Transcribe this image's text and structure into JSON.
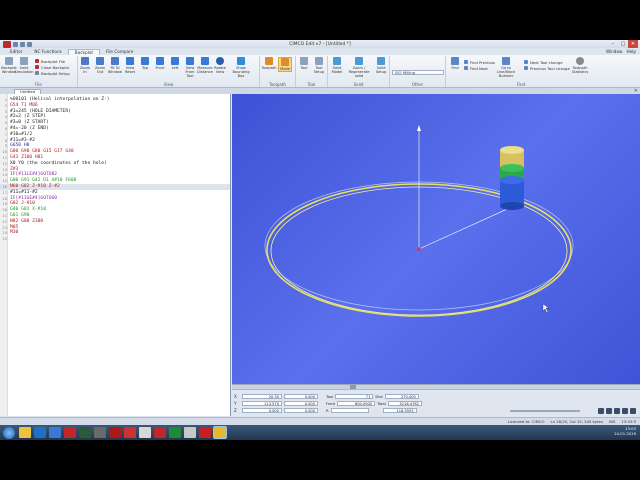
{
  "window": {
    "title": "CIMCO Edit v7 - [Untitled *]",
    "controls": [
      "–",
      "□",
      "✕"
    ]
  },
  "ribbon": {
    "tabs": [
      "Editor",
      "NC Functions",
      "Backplot",
      "File Compare"
    ],
    "active_tab": "Backplot",
    "right_items": [
      "Window",
      "Help"
    ],
    "groups": {
      "file": {
        "label": "File",
        "buttons": [
          "Backplot Window",
          "Solid Simulation"
        ],
        "small": [
          "Backplot File",
          "Close Backplot",
          "Backplot Setup"
        ]
      },
      "view": {
        "label": "View",
        "buttons": [
          "Zoom In",
          "Zoom Out",
          "Fit To Window",
          "View Reset",
          "Top",
          "Front",
          "Left",
          "View From Tool",
          "Measure Distance",
          "Rotate View",
          "Show Bounding Box"
        ]
      },
      "toolpath": {
        "label": "Toolpath",
        "buttons": [
          "Toolpath",
          "Mode"
        ]
      },
      "tool": {
        "label": "Tool",
        "buttons": [
          "Tool",
          "Tool Setup"
        ]
      },
      "solid": {
        "label": "Solid",
        "buttons": [
          "Solid Model",
          "Zoom / Regenerate solid",
          "Solid Setup"
        ]
      },
      "other": {
        "label": "Other",
        "combo_value": "ISO Milling"
      },
      "find": {
        "label": "Find",
        "buttons": [
          "Find"
        ],
        "small": [
          "Find Previous",
          "Find Next"
        ],
        "buttons2": [
          "Go to Line/Block Number"
        ],
        "small2": [
          "Next Tool change",
          "Previous Tool change"
        ],
        "buttons3": [
          "Toolpath Statistics"
        ]
      }
    }
  },
  "document": {
    "tab": "Untitled",
    "close_glyph": "✕"
  },
  "editor": {
    "lines": [
      {
        "n": "1",
        "parts": [
          {
            "t": "%O0101 (Helical interpolation on Z-)",
            "c": "black"
          }
        ]
      },
      {
        "n": "2",
        "parts": [
          {
            "t": "G54 T1 M06",
            "c": "red"
          }
        ]
      },
      {
        "n": "3",
        "parts": [
          {
            "t": "#1=245 (HOLE DIAMETER)",
            "c": "black"
          }
        ]
      },
      {
        "n": "4",
        "parts": [
          {
            "t": "#2=2 (Z STEP)",
            "c": "black"
          }
        ]
      },
      {
        "n": "5",
        "parts": [
          {
            "t": "#3=0 (Z START)",
            "c": "black"
          }
        ]
      },
      {
        "n": "6",
        "parts": [
          {
            "t": "#4=-20 (Z END)",
            "c": "black"
          }
        ]
      },
      {
        "n": "7",
        "parts": [
          {
            "t": "#10=#1/2",
            "c": "black"
          }
        ]
      },
      {
        "n": "8",
        "parts": [
          {
            "t": "#11=#3-#2",
            "c": "black"
          }
        ]
      },
      {
        "n": "9",
        "parts": [
          {
            "t": "G650 H0",
            "c": "blue"
          }
        ]
      },
      {
        "n": "10",
        "parts": [
          {
            "t": "G00 G90 G80 G15 G17 G40",
            "c": "red"
          }
        ]
      },
      {
        "n": "11",
        "parts": [
          {
            "t": "G43 Z100 H01",
            "c": "red"
          }
        ]
      },
      {
        "n": "12",
        "parts": [
          {
            "t": "X0 Y0 (the coordinates of the hole)",
            "c": "black"
          }
        ]
      },
      {
        "n": "13",
        "parts": [
          {
            "t": "Z#3",
            "c": "red"
          }
        ]
      },
      {
        "n": "14",
        "parts": [
          {
            "t": "IF[#11LE#4]GOTO82",
            "c": "purple"
          }
        ]
      },
      {
        "n": "15",
        "parts": [
          {
            "t": "G00 G91 G42 D1 X#10 F600",
            "c": "green"
          }
        ]
      },
      {
        "n": "16",
        "parts": [
          {
            "t": "N60 G02 Z-#10 Z-#2",
            "c": "red"
          }
        ],
        "highlight": true
      },
      {
        "n": "17",
        "parts": [
          {
            "t": "#11=#11-#2",
            "c": "black"
          }
        ]
      },
      {
        "n": "18",
        "parts": [
          {
            "t": "IF[#11GE#4]GOTO60",
            "c": "purple"
          }
        ]
      },
      {
        "n": "19",
        "parts": [
          {
            "t": "G02 J-#10",
            "c": "red"
          }
        ]
      },
      {
        "n": "20",
        "parts": [
          {
            "t": "G40 G01 X-#10",
            "c": "green"
          }
        ]
      },
      {
        "n": "21",
        "parts": [
          {
            "t": "G01 G90",
            "c": "green"
          }
        ]
      },
      {
        "n": "22",
        "parts": [
          {
            "t": "N82 G00 Z300",
            "c": "red"
          }
        ]
      },
      {
        "n": "23",
        "parts": [
          {
            "t": "M05",
            "c": "red"
          }
        ]
      },
      {
        "n": "24",
        "parts": [
          {
            "t": "M30",
            "c": "red"
          }
        ]
      },
      {
        "n": "25",
        "parts": [
          {
            "t": "",
            "c": "black"
          }
        ]
      }
    ]
  },
  "dro": {
    "rows": [
      {
        "axis": "X",
        "v1": "20.35",
        "v2": "0.000",
        "tag1": "Tool",
        "f1": "T1",
        "tag2": "Dist",
        "f2": "270.000"
      },
      {
        "axis": "Y",
        "v1": "113.570",
        "v2": "0.000",
        "tag1": "Feed",
        "f1": "600.0000",
        "tag2": "Total",
        "f2": "5216.4762"
      },
      {
        "axis": "Z",
        "v1": "0.000",
        "v2": "0.000",
        "tag1": "R",
        "f1": "",
        "tag2": "",
        "f2": "116.5555"
      }
    ]
  },
  "status": {
    "left": "",
    "items": [
      "Licensed to: CIMCO",
      "Ln 16/25, Col 15, 345 bytes",
      "INS",
      "13:53:5"
    ]
  },
  "taskbar": {
    "clock_time": "13:03",
    "clock_date": "24.01.2019"
  },
  "colors": {
    "viewport_bg": "#4a5fe2",
    "toolpath": "#e8e060",
    "tool_top": "#d8c060",
    "tool_mid": "#2aa84a",
    "tool_bottom": "#2d5bd8"
  }
}
